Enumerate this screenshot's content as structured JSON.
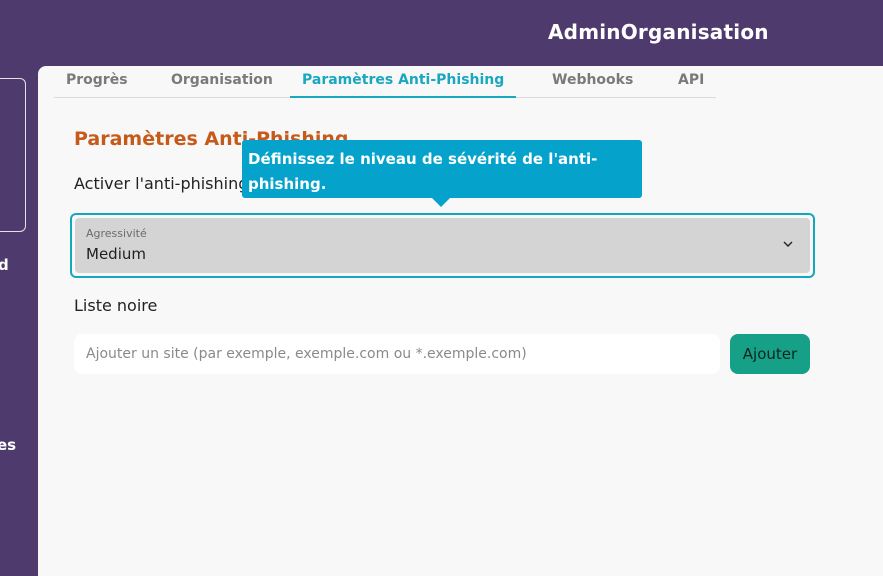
{
  "header": {
    "title": "AdminOrganisation"
  },
  "sidebar": {
    "fragments": [
      "d",
      "es"
    ]
  },
  "tabs": [
    {
      "label": "Progrès"
    },
    {
      "label": "Organisation"
    },
    {
      "label": "Paramètres Anti-Phishing"
    },
    {
      "label": "Webhooks"
    },
    {
      "label": "API"
    }
  ],
  "active_tab": "Paramètres Anti-Phishing",
  "section": {
    "title": "Paramètres Anti-Phishing",
    "enable_label": "Activer l'anti-phishing"
  },
  "tooltip": {
    "text": "Définissez le niveau de sévérité de l'anti-phishing."
  },
  "aggressiveness": {
    "label": "Agressivité",
    "value": "Medium"
  },
  "blacklist": {
    "label": "Liste noire",
    "placeholder": "Ajouter un site (par exemple, exemple.com ou *.exemple.com)",
    "add_label": "Ajouter"
  },
  "colors": {
    "background": "#4f3a6e",
    "accent": "#1aa7c0",
    "title": "#c65a1a",
    "tooltip": "#05a3cc",
    "button": "#15a087"
  }
}
